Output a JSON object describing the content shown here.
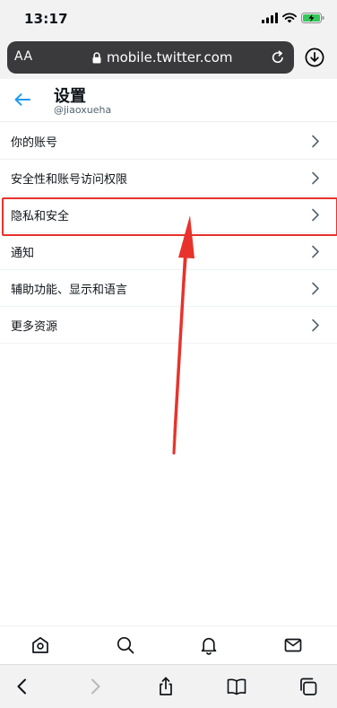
{
  "status_bar": {
    "time": "13:17"
  },
  "browser": {
    "text_size_label": "AA",
    "url": "mobile.twitter.com"
  },
  "header": {
    "title": "设置",
    "handle": "@jiaoxueha"
  },
  "settings": {
    "items": [
      {
        "label": "你的账号"
      },
      {
        "label": "安全性和账号访问权限"
      },
      {
        "label": "隐私和安全"
      },
      {
        "label": "通知"
      },
      {
        "label": "辅助功能、显示和语言"
      },
      {
        "label": "更多资源"
      }
    ],
    "highlighted_item": "隐私和安全"
  },
  "bottom_nav": [
    "home-icon",
    "search-icon",
    "bell-icon",
    "mail-icon"
  ],
  "safari_toolbar": [
    "back-icon",
    "forward-icon",
    "share-icon",
    "bookmarks-icon",
    "tabs-icon"
  ],
  "colors": {
    "accent": "#1d9bf0",
    "annotation": "#e8322b",
    "battery": "#34c759"
  }
}
